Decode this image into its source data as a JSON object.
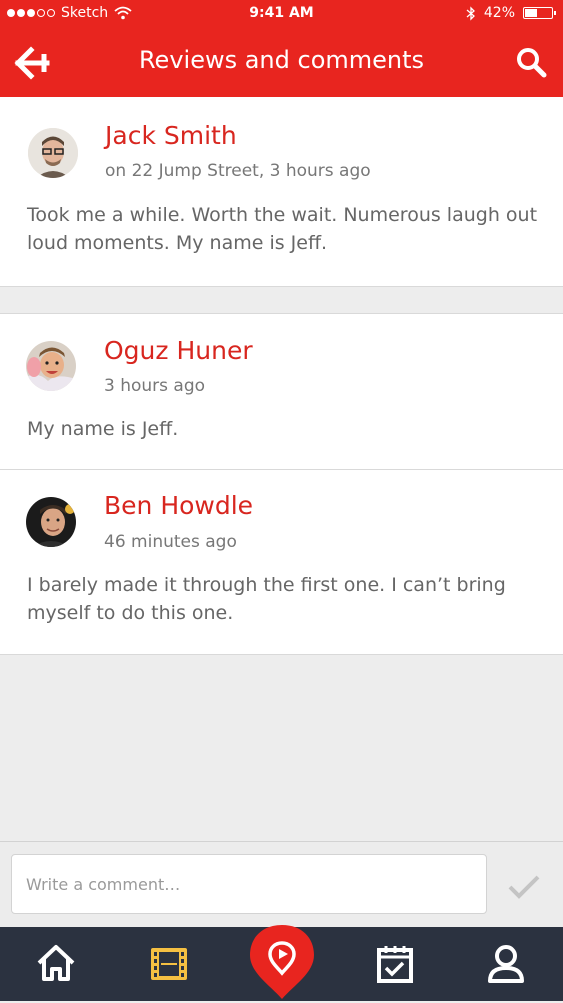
{
  "status_bar": {
    "carrier": "Sketch",
    "time": "9:41 AM",
    "battery": "42%",
    "battery_level": 0.42
  },
  "nav": {
    "title": "Reviews and comments",
    "back_icon": "arrow-left-icon",
    "search_icon": "search-icon"
  },
  "reviews": [
    {
      "name": "Jack Smith",
      "meta": "on 22 Jump Street, 3 hours ago",
      "text": "Took me a while. Worth the wait. Numerous laugh out loud moments. My name is Jeff."
    },
    {
      "name": "Oguz Huner",
      "meta": "3 hours ago",
      "text": "My name is Jeff."
    },
    {
      "name": "Ben Howdle",
      "meta": "46 minutes ago",
      "text": "I barely made it through the first one. I can’t bring myself to do this one."
    }
  ],
  "composer": {
    "placeholder": "Write a comment…",
    "send_icon": "checkmark-icon"
  },
  "tabs": [
    "home-icon",
    "film-icon",
    "location-pin-icon",
    "calendar-check-icon",
    "user-icon"
  ],
  "colors": {
    "accent": "#e8251f",
    "tabbar": "#2b3240",
    "active_tab": "#f5c042"
  }
}
